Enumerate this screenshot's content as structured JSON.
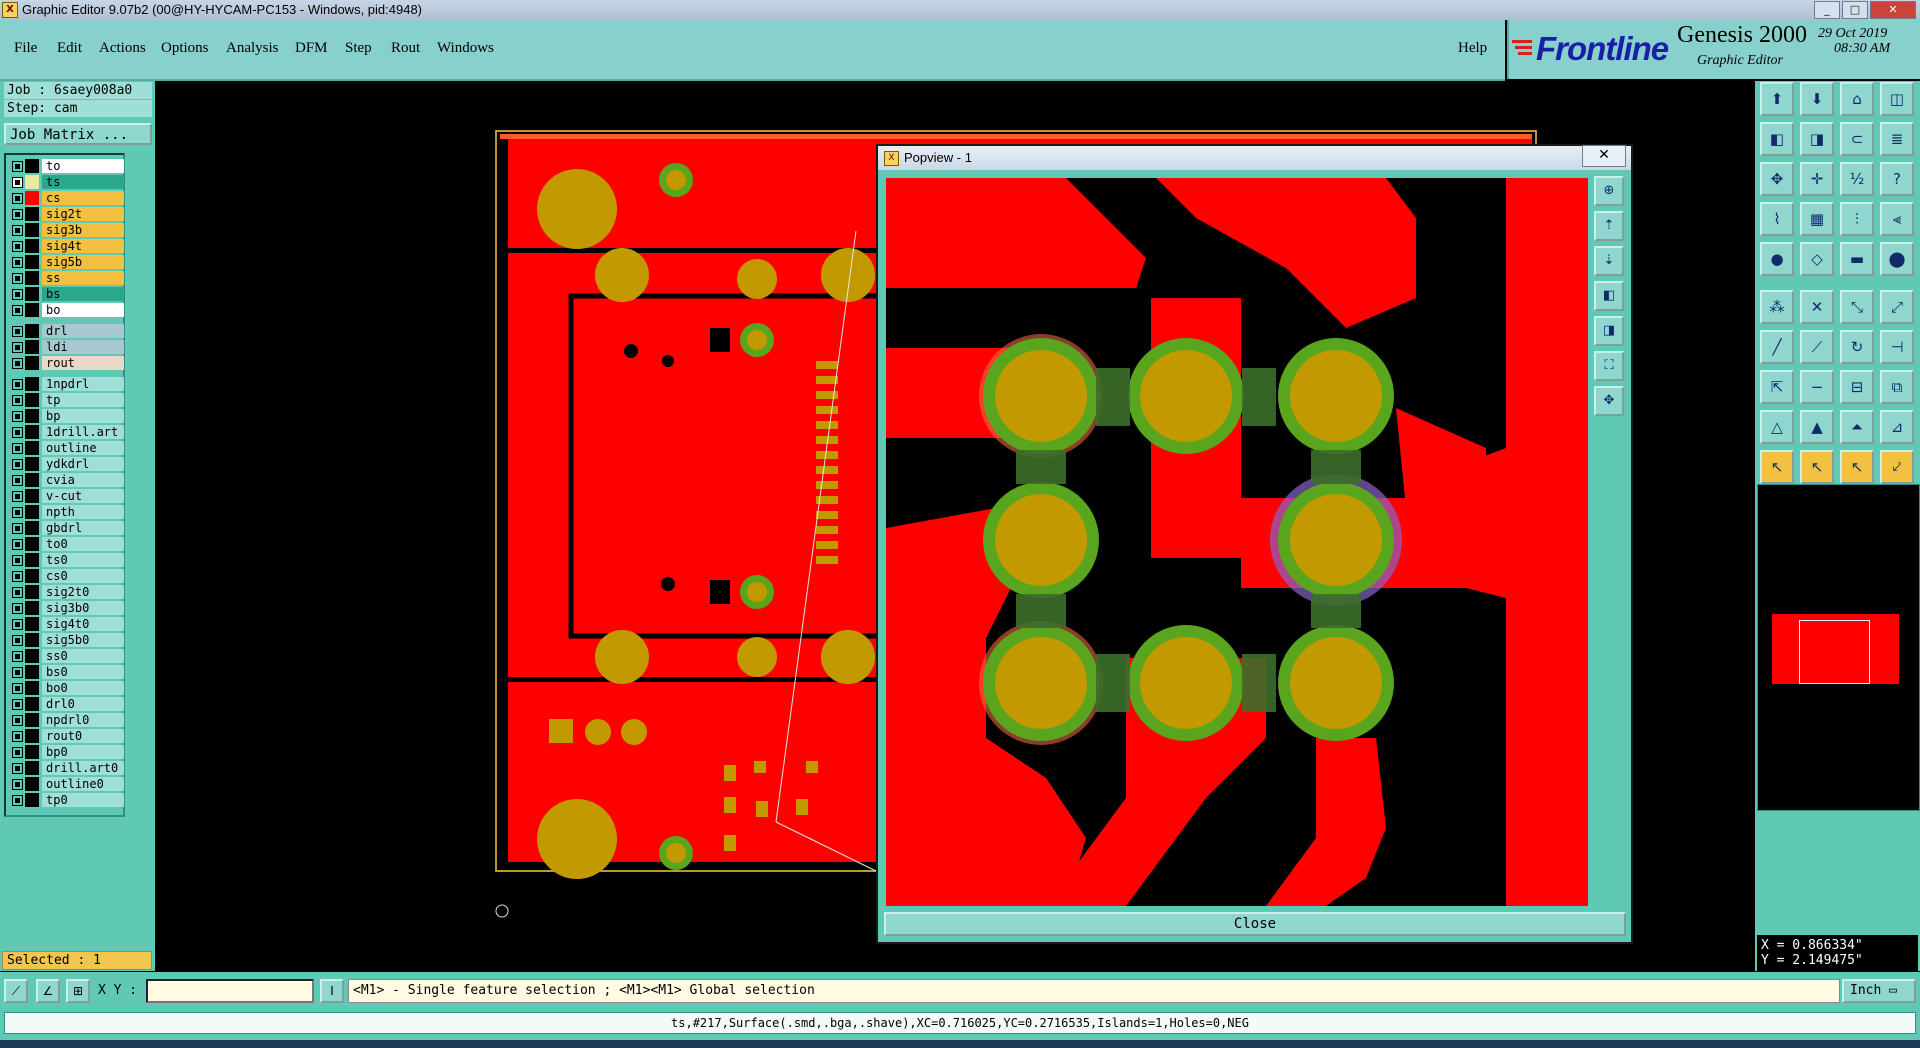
{
  "window": {
    "title": "Graphic Editor 9.07b2 (00@HY-HYCAM-PC153 - Windows, pid:4948)"
  },
  "menu": {
    "items": [
      "File",
      "Edit",
      "Actions",
      "Options",
      "Analysis",
      "DFM",
      "Step",
      "Rout",
      "Windows"
    ],
    "help": "Help"
  },
  "brand": {
    "logo": "Frontline",
    "product": "Genesis 2000",
    "subtitle": "Graphic Editor",
    "date": "29 Oct 2019",
    "time": "08:30 AM"
  },
  "job": {
    "job_line": "Job : 6saey008a0",
    "step_line": "Step: cam",
    "matrix_button": "Job Matrix ..."
  },
  "layers": [
    {
      "name": "to",
      "color": "#ffffff",
      "swatch": "#000000",
      "edit": "✐"
    },
    {
      "name": "ts",
      "color": "#2aa88e",
      "swatch": "#e8e8a0",
      "edit": "≡",
      "marked": true
    },
    {
      "name": "cs",
      "color": "#f2c040",
      "swatch": "#ff0000"
    },
    {
      "name": "sig2t",
      "color": "#f2c040",
      "swatch": ""
    },
    {
      "name": "sig3b",
      "color": "#f2c040",
      "swatch": ""
    },
    {
      "name": "sig4t",
      "color": "#f2c040",
      "swatch": ""
    },
    {
      "name": "sig5b",
      "color": "#f2c040",
      "swatch": ""
    },
    {
      "name": "ss",
      "color": "#f2c040",
      "swatch": ""
    },
    {
      "name": "bs",
      "color": "#2aa88e",
      "swatch": ""
    },
    {
      "name": "bo",
      "color": "#ffffff",
      "swatch": "",
      "edit": "✐"
    },
    {
      "name": "drl",
      "color": "#a8c8d0",
      "swatch": "",
      "gap": true
    },
    {
      "name": "ldi",
      "color": "#a8c8d0",
      "swatch": ""
    },
    {
      "name": "rout",
      "color": "#e8d8c8",
      "swatch": ""
    },
    {
      "name": "1npdrl",
      "color": "#9ee0d8",
      "swatch": "",
      "gap": true
    },
    {
      "name": "tp",
      "color": "#9ee0d8",
      "swatch": ""
    },
    {
      "name": "bp",
      "color": "#9ee0d8",
      "swatch": ""
    },
    {
      "name": "1drill.art",
      "color": "#9ee0d8",
      "swatch": ""
    },
    {
      "name": "outline",
      "color": "#9ee0d8",
      "swatch": ""
    },
    {
      "name": "ydkdrl",
      "color": "#9ee0d8",
      "swatch": ""
    },
    {
      "name": "cvia",
      "color": "#9ee0d8",
      "swatch": ""
    },
    {
      "name": "v-cut",
      "color": "#9ee0d8",
      "swatch": ""
    },
    {
      "name": "npth",
      "color": "#9ee0d8",
      "swatch": ""
    },
    {
      "name": "gbdrl",
      "color": "#9ee0d8",
      "swatch": ""
    },
    {
      "name": "to0",
      "color": "#9ee0d8",
      "swatch": "",
      "edit": "✐"
    },
    {
      "name": "ts0",
      "color": "#9ee0d8",
      "swatch": ""
    },
    {
      "name": "cs0",
      "color": "#9ee0d8",
      "swatch": ""
    },
    {
      "name": "sig2t0",
      "color": "#9ee0d8",
      "swatch": ""
    },
    {
      "name": "sig3b0",
      "color": "#9ee0d8",
      "swatch": ""
    },
    {
      "name": "sig4t0",
      "color": "#9ee0d8",
      "swatch": ""
    },
    {
      "name": "sig5b0",
      "color": "#9ee0d8",
      "swatch": ""
    },
    {
      "name": "ss0",
      "color": "#9ee0d8",
      "swatch": ""
    },
    {
      "name": "bs0",
      "color": "#9ee0d8",
      "swatch": ""
    },
    {
      "name": "bo0",
      "color": "#9ee0d8",
      "swatch": "",
      "edit": "✐"
    },
    {
      "name": "drl0",
      "color": "#9ee0d8",
      "swatch": ""
    },
    {
      "name": "npdrl0",
      "color": "#9ee0d8",
      "swatch": ""
    },
    {
      "name": "rout0",
      "color": "#9ee0d8",
      "swatch": ""
    },
    {
      "name": "bp0",
      "color": "#9ee0d8",
      "swatch": ""
    },
    {
      "name": "drill.art0",
      "color": "#9ee0d8",
      "swatch": ""
    },
    {
      "name": "outline0",
      "color": "#9ee0d8",
      "swatch": ""
    },
    {
      "name": "tp0",
      "color": "#9ee0d8",
      "swatch": ""
    }
  ],
  "selection": {
    "text": "Selected : 1"
  },
  "toolbox_icons": [
    "step-icon",
    "open-icon",
    "home-icon",
    "window-icon",
    "left-icon",
    "right-icon",
    "zoom-icon",
    "snap-icon",
    "fit-icon",
    "pan-icon",
    "scale-icon",
    "help-icon",
    "measure-icon",
    "grid-icon",
    "route-icon",
    "route2-icon",
    "add-pad-icon",
    "shape-icon",
    "ruler-icon",
    "dot-icon",
    "connect-icon",
    "cross-icon",
    "node-icon",
    "node2-icon",
    "line-icon",
    "line2-icon",
    "arc-icon",
    "align-icon",
    "move-icon",
    "minus-icon",
    "copy-icon",
    "resize-icon",
    "triangle-icon",
    "triangle2-icon",
    "triangle3-icon",
    "triangle4-icon",
    "pointer-icon",
    "pointer2-icon",
    "pointer3-icon",
    "pointer4-icon"
  ],
  "coords": {
    "x": "X = 0.866334\"",
    "y": "Y = 2.149475\""
  },
  "bottom": {
    "xy_label": "X Y :",
    "xy_value": "",
    "hint": "<M1> - Single feature selection ; <M1><M1> Global selection",
    "units": "Inch"
  },
  "status": {
    "text": "ts,#217,Surface(.smd,.bga,.shave),XC=0.716025,YC=0.2716535,Islands=1,Holes=0,NEG"
  },
  "popview": {
    "title": "Popview - 1",
    "close_x": "✕",
    "close_button": "Close"
  },
  "colors": {
    "accent": "#5fc9b6",
    "board": "#ff0000",
    "pad": "#c29a00",
    "via_ring": "#5aa51e"
  }
}
